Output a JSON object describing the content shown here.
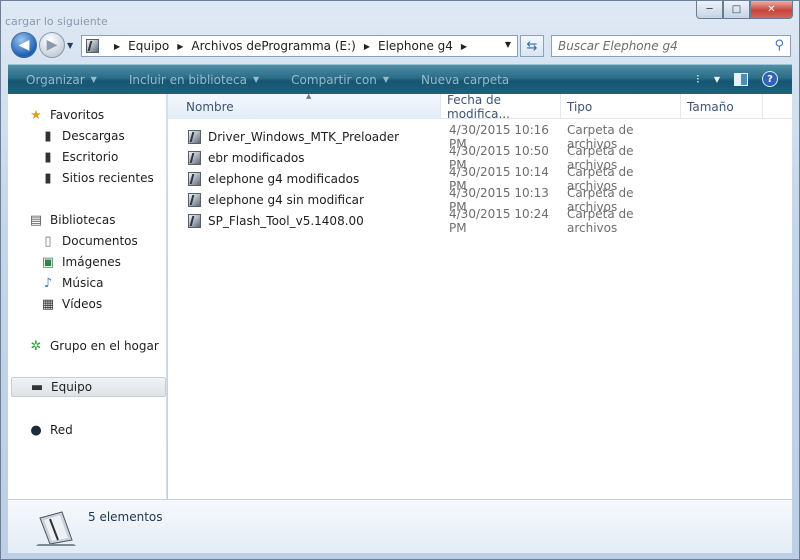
{
  "window": {
    "background_hint": "cargar lo siguiente",
    "caption": {
      "min": "─",
      "max": "□",
      "close": "✕"
    }
  },
  "address_bar": {
    "segments": [
      "Equipo",
      "Archivos deProgramma (E:)",
      "Elephone g4"
    ]
  },
  "search": {
    "placeholder": "Buscar Elephone g4"
  },
  "command_bar": {
    "items": [
      "Organizar",
      "Incluir en biblioteca",
      "Compartir con",
      "Nueva carpeta"
    ],
    "help": "?"
  },
  "nav_pane": {
    "favorites": {
      "label": "Favoritos",
      "items": [
        "Descargas",
        "Escritorio",
        "Sitios recientes"
      ]
    },
    "libraries": {
      "label": "Bibliotecas",
      "items": [
        "Documentos",
        "Imágenes",
        "Música",
        "Vídeos"
      ]
    },
    "homegroup": "Grupo en el hogar",
    "computer": "Equipo",
    "network": "Red"
  },
  "columns": {
    "name": "Nombre",
    "date": "Fecha de modifica...",
    "type": "Tipo",
    "size": "Tamaño"
  },
  "files": [
    {
      "name": "Driver_Windows_MTK_Preloader",
      "date": "4/30/2015 10:16 PM",
      "type": "Carpeta de archivos"
    },
    {
      "name": "ebr modificados",
      "date": "4/30/2015 10:50 PM",
      "type": "Carpeta de archivos"
    },
    {
      "name": "elephone g4 modificados",
      "date": "4/30/2015 10:14 PM",
      "type": "Carpeta de archivos"
    },
    {
      "name": "elephone g4 sin modificar",
      "date": "4/30/2015 10:13 PM",
      "type": "Carpeta de archivos"
    },
    {
      "name": "SP_Flash_Tool_v5.1408.00",
      "date": "4/30/2015 10:24 PM",
      "type": "Carpeta de archivos"
    }
  ],
  "details": {
    "count": "5 elementos"
  }
}
